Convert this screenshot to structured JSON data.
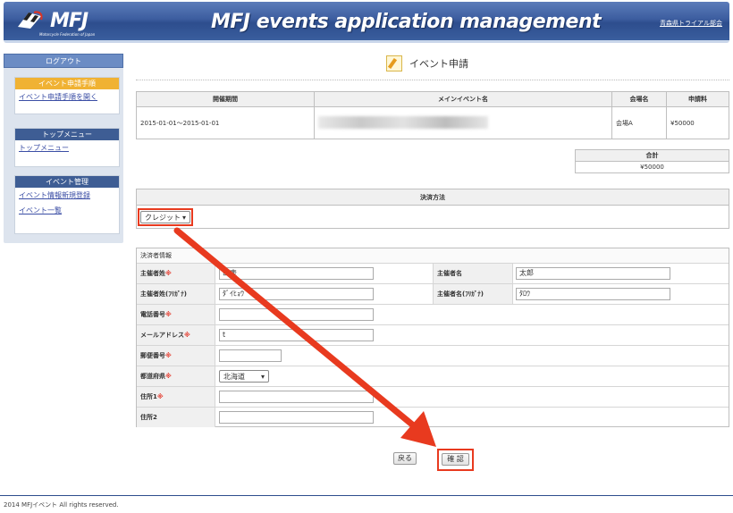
{
  "header": {
    "logo_text": "MFJ",
    "logo_sub": "Motorcycle Federation of Japan",
    "title": "MFJ events application management",
    "user_link": "青森県トライアル部会"
  },
  "sidebar": {
    "logout": "ログアウト",
    "sections": [
      {
        "heading": "イベント申請手順",
        "links": [
          "イベント申請手順を開く"
        ]
      },
      {
        "heading": "トップメニュー",
        "links": [
          "トップメニュー"
        ]
      },
      {
        "heading": "イベント管理",
        "links": [
          "イベント情報新規登録",
          "イベント一覧"
        ]
      }
    ]
  },
  "page": {
    "title": "イベント申請"
  },
  "event_table": {
    "headers": [
      "開催期間",
      "メインイベント名",
      "会場名",
      "申請料"
    ],
    "row": {
      "period": "2015-01-01～2015-01-01",
      "venue": "会場A",
      "fee": "¥50000"
    }
  },
  "total": {
    "label": "合計",
    "value": "¥50000"
  },
  "payment": {
    "heading": "決済方法",
    "selected": "クレジット"
  },
  "payer": {
    "heading": "決済者情報",
    "fields": {
      "last_name": {
        "label": "主催者姓",
        "value": "山表"
      },
      "first_name": {
        "label": "主催者名",
        "value": "太郎"
      },
      "last_name_kana": {
        "label": "主催者姓(ﾌﾘｶﾞﾅ)",
        "value": "ﾀﾞｲﾋｮｳ"
      },
      "first_name_kana": {
        "label": "主催者名(ﾌﾘｶﾞﾅ)",
        "value": "ﾀﾛｳ"
      },
      "phone": {
        "label": "電話番号",
        "value": ""
      },
      "email": {
        "label": "メールアドレス",
        "value": "t"
      },
      "postal": {
        "label": "郵便番号",
        "value": ""
      },
      "prefecture": {
        "label": "都道府県",
        "value": "北海道"
      },
      "address1": {
        "label": "住所1",
        "value": ""
      },
      "address2": {
        "label": "住所2",
        "value": ""
      }
    },
    "required_mark": "※"
  },
  "buttons": {
    "back": "戻る",
    "confirm": "確 認"
  },
  "footer": {
    "copyright": "2014 MFJイベント All rights reserved."
  },
  "colors": {
    "header_blue": "#3c5d9f",
    "highlight_red": "#e83a1f",
    "menu_orange": "#f0b233"
  }
}
